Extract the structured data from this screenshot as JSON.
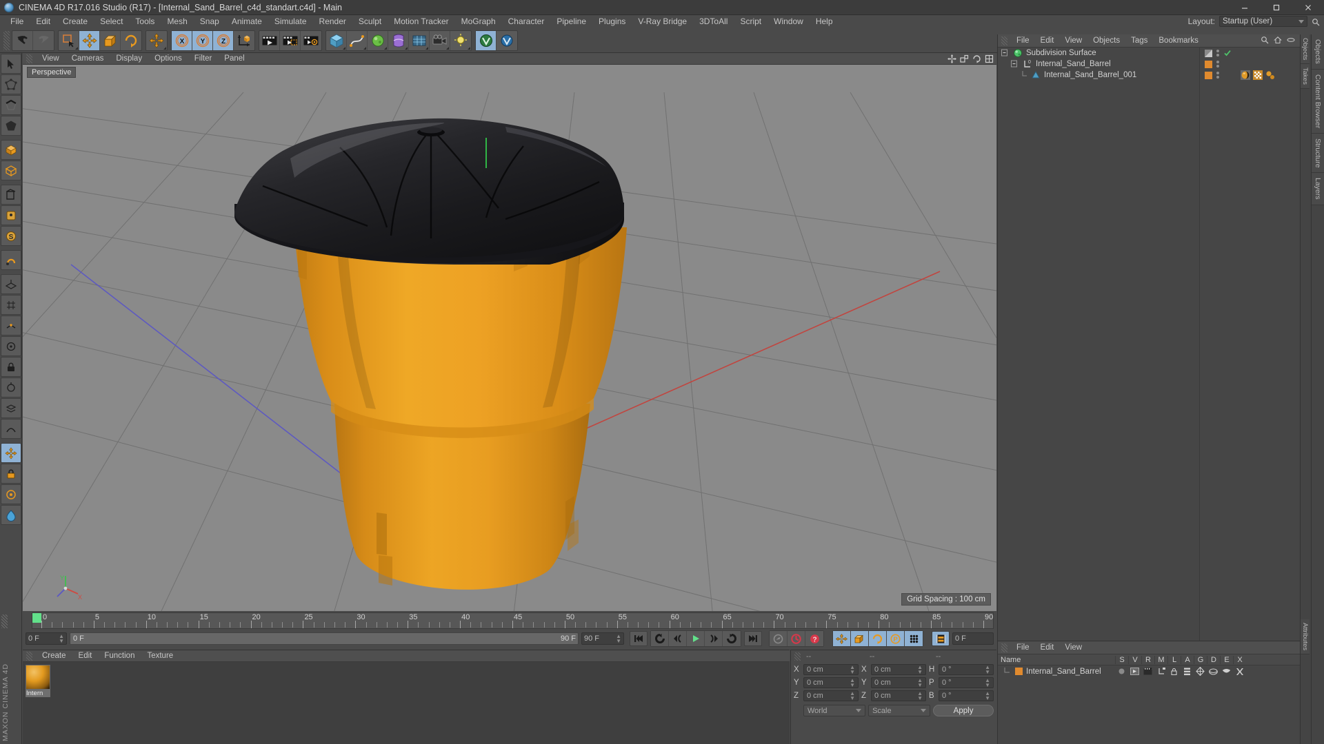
{
  "window": {
    "title": "CINEMA 4D R17.016 Studio (R17) - [Internal_Sand_Barrel_c4d_standart.c4d] - Main",
    "minimize": "–",
    "maximize": "□",
    "close": "✕"
  },
  "menubar": {
    "items": [
      "File",
      "Edit",
      "Create",
      "Select",
      "Tools",
      "Mesh",
      "Snap",
      "Animate",
      "Simulate",
      "Render",
      "Sculpt",
      "Motion Tracker",
      "MoGraph",
      "Character",
      "Pipeline",
      "Plugins",
      "V-Ray Bridge",
      "3DToAll",
      "Script",
      "Window",
      "Help"
    ],
    "layout_label": "Layout:",
    "layout_value": "Startup (User)"
  },
  "toolbar": {
    "groups": [
      {
        "name": "history",
        "buttons": [
          {
            "icon": "undo-icon",
            "state": "normal"
          },
          {
            "icon": "redo-icon",
            "state": "disabled"
          }
        ]
      },
      {
        "name": "modes",
        "buttons": [
          {
            "icon": "select-live-icon",
            "state": "normal"
          },
          {
            "icon": "move-icon",
            "state": "active"
          },
          {
            "icon": "scale-icon",
            "state": "normal"
          },
          {
            "icon": "rotate-icon",
            "state": "normal"
          }
        ]
      },
      {
        "name": "move-dup",
        "buttons": [
          {
            "icon": "move-tool-icon",
            "state": "normal"
          }
        ]
      },
      {
        "name": "axis-locks",
        "buttons": [
          {
            "icon": "axis-x-icon",
            "state": "active"
          },
          {
            "icon": "axis-y-icon",
            "state": "active"
          },
          {
            "icon": "axis-z-icon",
            "state": "active"
          },
          {
            "icon": "world-axis-icon",
            "state": "normal"
          }
        ]
      },
      {
        "name": "render",
        "buttons": [
          {
            "icon": "render-view-icon",
            "state": "normal"
          },
          {
            "icon": "render-region-icon",
            "state": "normal"
          },
          {
            "icon": "render-settings-icon",
            "state": "normal"
          }
        ]
      },
      {
        "name": "primitives",
        "buttons": [
          {
            "icon": "cube-icon",
            "state": "normal"
          },
          {
            "icon": "spline-pen-icon",
            "state": "normal"
          },
          {
            "icon": "generator-icon",
            "state": "normal"
          },
          {
            "icon": "deformer-icon",
            "state": "normal"
          },
          {
            "icon": "scene-object-icon",
            "state": "normal"
          },
          {
            "icon": "camera-icon",
            "state": "normal"
          },
          {
            "icon": "light-icon",
            "state": "normal"
          }
        ]
      },
      {
        "name": "vray",
        "buttons": [
          {
            "icon": "vray-icon",
            "state": "active"
          },
          {
            "icon": "vray-settings-icon",
            "state": "normal"
          }
        ]
      }
    ]
  },
  "lefttoolbar": {
    "buttons": [
      {
        "icon": "select-mode-icon",
        "state": "normal"
      },
      {
        "icon": "point-mode-icon",
        "state": "normal"
      },
      {
        "icon": "edge-mode-icon",
        "state": "normal"
      },
      {
        "icon": "polygon-mode-icon",
        "state": "normal"
      },
      {
        "icon": "model-mode-icon",
        "state": "normal"
      },
      {
        "icon": "object-mode-icon",
        "state": "normal"
      },
      {
        "icon": "texture-mode-icon",
        "state": "normal"
      },
      {
        "icon": "axis-mode-icon",
        "state": "normal"
      },
      {
        "icon": "enable-axis-icon",
        "state": "normal"
      },
      {
        "icon": "snap-icon",
        "state": "normal"
      },
      {
        "icon": "workplane-icon",
        "state": "normal"
      },
      {
        "icon": "quantize-icon",
        "state": "normal"
      },
      {
        "icon": "locked-workplane-icon",
        "state": "normal"
      },
      {
        "icon": "planar-icon",
        "state": "normal"
      },
      {
        "icon": "pivot-icon",
        "state": "normal"
      },
      {
        "icon": "viewport-solo-icon",
        "state": "normal"
      },
      {
        "icon": "layer-icon",
        "state": "normal"
      },
      {
        "icon": "deform-icon",
        "state": "normal"
      },
      {
        "icon": "visibility-icon",
        "state": "active"
      },
      {
        "icon": "lock-icon",
        "state": "normal"
      },
      {
        "icon": "selection-filter-icon",
        "state": "normal"
      },
      {
        "icon": "color-icon",
        "state": "normal"
      }
    ],
    "brand_top": "MAXON",
    "brand_bottom": "CINEMA 4D"
  },
  "viewport": {
    "menu": [
      "View",
      "Cameras",
      "Display",
      "Options",
      "Filter",
      "Panel"
    ],
    "label": "Perspective",
    "grid_spacing": "Grid Spacing : 100 cm",
    "icons": [
      "move-view-icon",
      "scale-view-icon",
      "rotate-view-icon",
      "maximize-view-icon"
    ]
  },
  "timeline": {
    "ticks": [
      {
        "v": "0",
        "x": 0
      },
      {
        "v": "5",
        "x": 5
      },
      {
        "v": "10",
        "x": 10
      },
      {
        "v": "15",
        "x": 15
      },
      {
        "v": "20",
        "x": 20
      },
      {
        "v": "25",
        "x": 25
      },
      {
        "v": "30",
        "x": 30
      },
      {
        "v": "35",
        "x": 35
      },
      {
        "v": "40",
        "x": 40
      },
      {
        "v": "45",
        "x": 45
      },
      {
        "v": "50",
        "x": 50
      },
      {
        "v": "55",
        "x": 55
      },
      {
        "v": "60",
        "x": 60
      },
      {
        "v": "65",
        "x": 65
      },
      {
        "v": "70",
        "x": 70
      },
      {
        "v": "75",
        "x": 75
      },
      {
        "v": "80",
        "x": 80
      },
      {
        "v": "85",
        "x": 85
      },
      {
        "v": "90",
        "x": 90
      }
    ],
    "max_frame": 90,
    "current_frame_field": "0 F",
    "range_start": "0 F",
    "range_end": "90 F",
    "end_frame_field": "90 F",
    "right_frame_field": "0 F",
    "transport": [
      {
        "icon": "go-to-start-icon"
      },
      {
        "icon": "play-backwards-loop-icon"
      },
      {
        "icon": "previous-key-icon"
      },
      {
        "icon": "play-icon",
        "state": "active-green"
      },
      {
        "icon": "next-key-icon"
      },
      {
        "icon": "play-forward-loop-icon"
      },
      {
        "icon": "go-to-end-icon"
      }
    ],
    "record_group": [
      {
        "icon": "autokey-icon",
        "state": "disabled"
      },
      {
        "icon": "record-active-objects-icon",
        "state": "red"
      },
      {
        "icon": "record-question-icon",
        "state": "red"
      }
    ],
    "key_group": [
      {
        "icon": "key-position-icon",
        "state": "active"
      },
      {
        "icon": "key-scale-icon",
        "state": "active"
      },
      {
        "icon": "key-rotation-icon",
        "state": "active"
      },
      {
        "icon": "key-param-icon",
        "state": "active"
      },
      {
        "icon": "key-pla-icon",
        "state": "active"
      }
    ],
    "extra_group": [
      {
        "icon": "keyframe-selection-icon",
        "state": "active"
      }
    ]
  },
  "materials": {
    "menu": [
      "Create",
      "Edit",
      "Function",
      "Texture"
    ],
    "items": [
      {
        "name": "Intern",
        "full_name": "Internal_Sand_Barrel"
      }
    ]
  },
  "coordinates": {
    "header_dashes": [
      "--",
      "--",
      "--"
    ],
    "rows": [
      {
        "axis": "X",
        "position": "0 cm",
        "axis2": "X",
        "size": "0 cm",
        "axis3": "H",
        "rot": "0 °"
      },
      {
        "axis": "Y",
        "position": "0 cm",
        "axis2": "Y",
        "size": "0 cm",
        "axis3": "P",
        "rot": "0 °"
      },
      {
        "axis": "Z",
        "position": "0 cm",
        "axis2": "Z",
        "size": "0 cm",
        "axis3": "B",
        "rot": "0 °"
      }
    ],
    "space_select": "World",
    "mode_select": "Scale",
    "apply_label": "Apply"
  },
  "objectmanager": {
    "menu": [
      "File",
      "Edit",
      "View",
      "Objects",
      "Tags",
      "Bookmarks"
    ],
    "icons": [
      "search-icon",
      "home-icon",
      "ellipse-icon",
      "add-layer-icon"
    ],
    "rows": [
      {
        "name": "Subdivision Surface",
        "depth": 0,
        "icon": "subdivision-surface-icon",
        "dot_color": "#8a8a8a",
        "checked": true,
        "tags": []
      },
      {
        "name": "Internal_Sand_Barrel",
        "depth": 1,
        "icon": "null-object-icon",
        "dot_color": "#e08a2e",
        "checked": false,
        "tags": []
      },
      {
        "name": "Internal_Sand_Barrel_001",
        "depth": 2,
        "icon": "polygon-object-icon",
        "dot_color": "#e08a2e",
        "checked": false,
        "tags": [
          "material-tag",
          "uvw-tag",
          "phong-tag"
        ]
      }
    ]
  },
  "attributes": {
    "menu": [
      "File",
      "Edit",
      "View"
    ],
    "columns": [
      "Name",
      "S",
      "V",
      "R",
      "M",
      "L",
      "A",
      "G",
      "D",
      "E",
      "X"
    ],
    "rows": [
      {
        "name": "Internal_Sand_Barrel",
        "swatch": "#e08a2e",
        "icons": [
          "dot-icon",
          "render-icon",
          "clapper-icon",
          "hierarchy-icon",
          "lock-icon",
          "animation-icon",
          "generator-icon",
          "deformer-icon",
          "expression-icon",
          "xpresso-icon"
        ]
      }
    ]
  },
  "edgetabs": {
    "right": [
      "Objects",
      "Takes",
      "Attributes"
    ],
    "far_right": [
      "Objects",
      "Content Browser",
      "Structure",
      "Layers"
    ]
  },
  "colors": {
    "accent_orange": "#e79b24",
    "barrel_body": "#e8991f",
    "barrel_lid": "#1f1f22",
    "viewport_bg": "#8a8a8a",
    "panel_bg": "#4a4a4a",
    "play_green": "#62e08a"
  }
}
